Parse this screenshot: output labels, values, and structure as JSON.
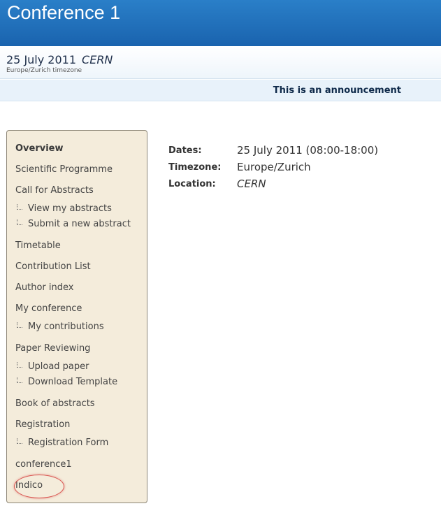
{
  "conference": {
    "title": "Conference 1",
    "date": "25 July 2011",
    "location": "CERN",
    "timezone_note": "Europe/Zurich timezone"
  },
  "announcement": "This is an announcement",
  "menu": {
    "overview": "Overview",
    "scientific_programme": "Scientific Programme",
    "call_for_abstracts": "Call for Abstracts",
    "view_my_abstracts": "View my abstracts",
    "submit_new_abstract": "Submit a new abstract",
    "timetable": "Timetable",
    "contribution_list": "Contribution List",
    "author_index": "Author index",
    "my_conference": "My conference",
    "my_contributions": "My contributions",
    "paper_reviewing": "Paper Reviewing",
    "upload_paper": "Upload paper",
    "download_template": "Download Template",
    "book_of_abstracts": "Book of abstracts",
    "registration": "Registration",
    "registration_form": "Registration Form",
    "conference1": "conference1",
    "indico": "Indico"
  },
  "details": {
    "dates_label": "Dates:",
    "dates_value": "25 July 2011 (08:00-18:00)",
    "timezone_label": "Timezone:",
    "timezone_value": "Europe/Zurich",
    "location_label": "Location:",
    "location_value": "CERN"
  },
  "colors": {
    "header_blue": "#1a63ae",
    "menu_background": "#f4ecdb",
    "highlight_circle": "#d9534f"
  }
}
